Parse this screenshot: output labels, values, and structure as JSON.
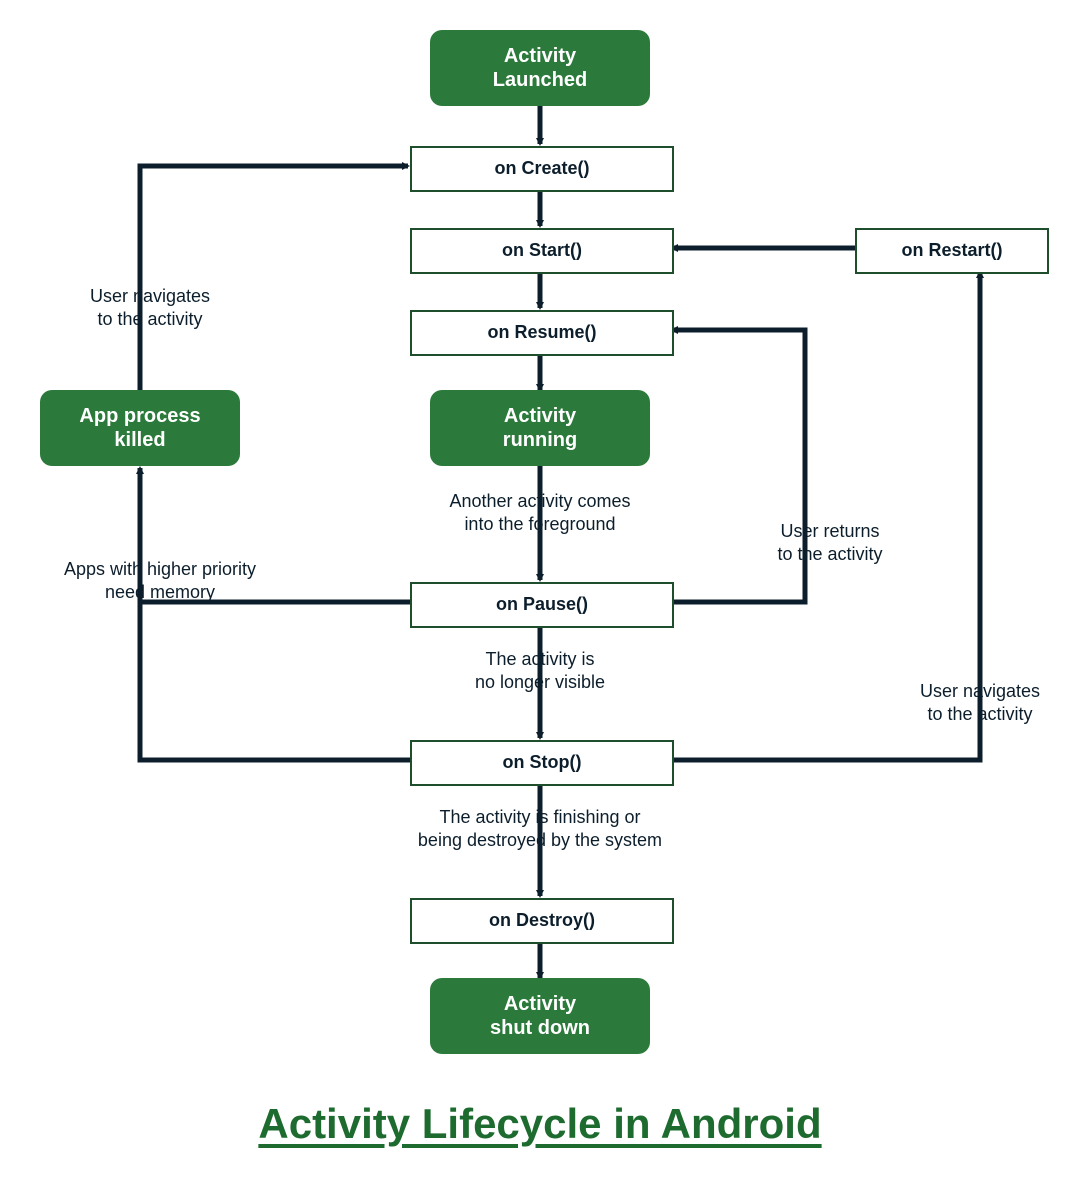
{
  "title": "Activity Lifecycle in Android",
  "colors": {
    "green": "#2b7a3b",
    "arrow": "#0c1e2c",
    "title": "#1e6b2f",
    "border": "#1e4e2b"
  },
  "nodes": {
    "activity_launched": "Activity\nLaunched",
    "on_create": "on Create()",
    "on_start": "on Start()",
    "on_resume": "on Resume()",
    "activity_running": "Activity\nrunning",
    "on_pause": "on Pause()",
    "on_stop": "on Stop()",
    "on_destroy": "on Destroy()",
    "activity_shut_down": "Activity\nshut down",
    "app_process_killed": "App process\nkilled",
    "on_restart": "on Restart()"
  },
  "labels": {
    "user_navigates_left": "User navigates\nto the activity",
    "another_activity": "Another activity comes\ninto the foreground",
    "user_returns": "User returns\nto the activity",
    "activity_no_longer_visible": "The activity is\nno longer visible",
    "user_navigates_right": "User navigates\nto the activity",
    "apps_higher_priority": "Apps with higher priority\nneed memory",
    "activity_finishing": "The activity is finishing or\nbeing destroyed by the system"
  }
}
